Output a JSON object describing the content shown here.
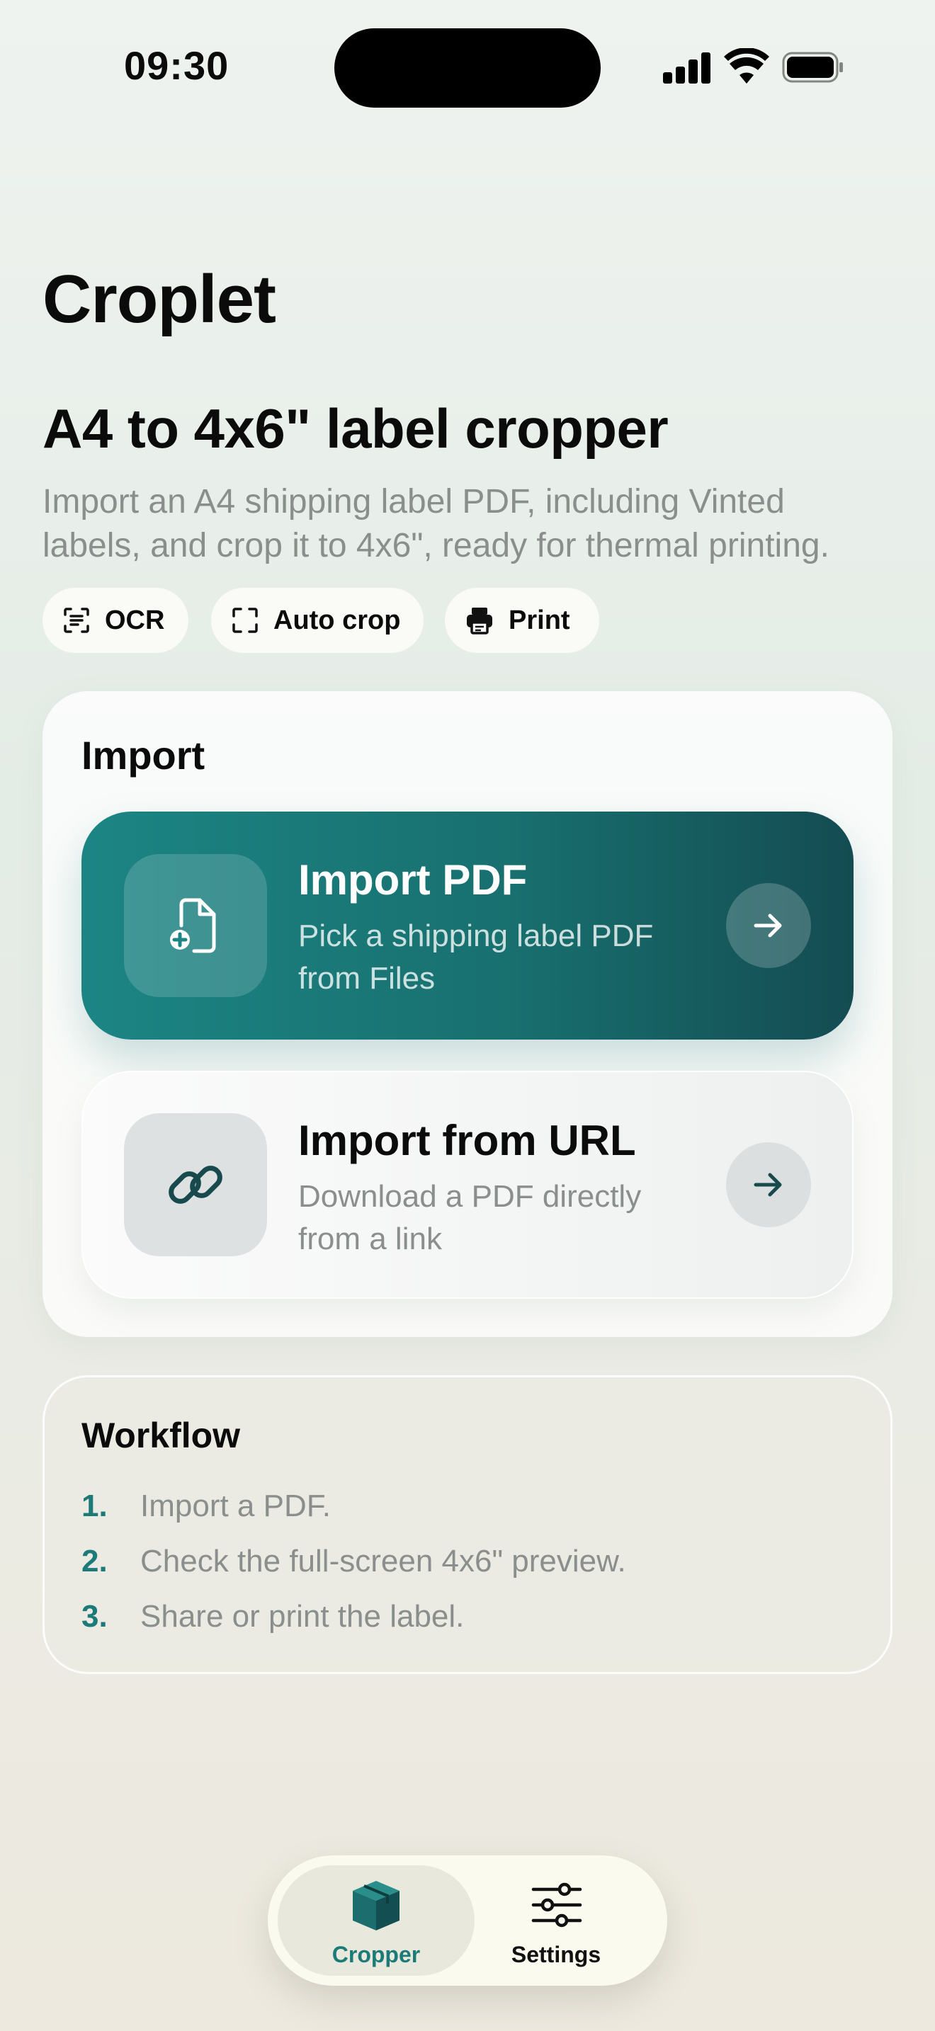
{
  "status_bar": {
    "time": "09:30"
  },
  "app": {
    "title": "Croplet"
  },
  "hero": {
    "headline": "A4 to 4x6\" label cropper",
    "description_line1": "Import an A4 shipping label PDF, including Vinted",
    "description_line2": "labels, and crop it to 4x6\", ready for thermal printing."
  },
  "chips": [
    {
      "label": "OCR",
      "icon": "ocr-scan-icon"
    },
    {
      "label": "Auto crop",
      "icon": "crop-corners-icon"
    },
    {
      "label": "Print",
      "icon": "printer-icon"
    }
  ],
  "import_card": {
    "title": "Import",
    "pdf": {
      "title": "Import PDF",
      "subtitle_line1": "Pick a shipping label PDF",
      "subtitle_line2": "from Files",
      "icon": "document-add-icon"
    },
    "url": {
      "title": "Import from URL",
      "subtitle_line1": "Download a PDF directly",
      "subtitle_line2": "from a link",
      "icon": "link-icon"
    }
  },
  "workflow": {
    "title": "Workflow",
    "steps": [
      {
        "num": "1.",
        "text": "Import a PDF."
      },
      {
        "num": "2.",
        "text": "Check the full-screen 4x6\" preview."
      },
      {
        "num": "3.",
        "text": "Share or print the label."
      }
    ]
  },
  "tab_bar": {
    "tabs": [
      {
        "label": "Cropper",
        "icon": "box-icon",
        "active": true
      },
      {
        "label": "Settings",
        "icon": "sliders-icon",
        "active": false
      }
    ]
  },
  "colors": {
    "accent": "#1c7a79",
    "accent_dark": "#144c52",
    "muted_text": "#8a8f8d"
  }
}
